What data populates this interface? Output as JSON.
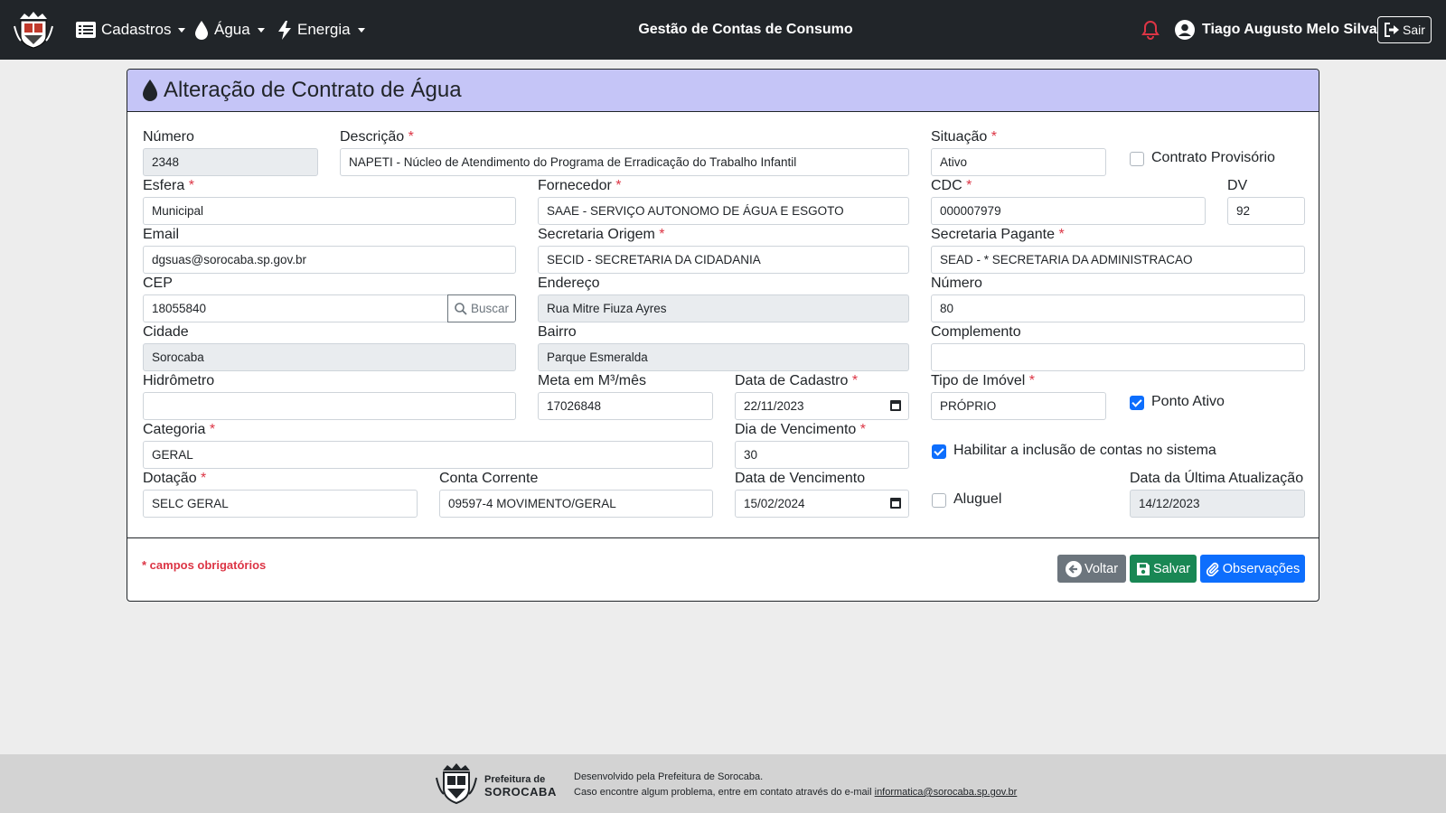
{
  "navbar": {
    "menus": [
      {
        "label": "Cadastros"
      },
      {
        "label": "Água"
      },
      {
        "label": "Energia"
      }
    ],
    "title": "Gestão de Contas de Consumo",
    "user_name": "Tiago Augusto Melo Silva",
    "logout_label": "Sair"
  },
  "card": {
    "title": "Alteração de Contrato de Água"
  },
  "form": {
    "numero": {
      "label": "Número",
      "value": "2348"
    },
    "descricao": {
      "label": "Descrição",
      "value": "NAPETI - Núcleo de Atendimento do Programa de Erradicação do Trabalho Infantil"
    },
    "situacao": {
      "label": "Situação",
      "value": "Ativo"
    },
    "contrato_provisorio": {
      "label": "Contrato Provisório",
      "checked": false
    },
    "esfera": {
      "label": "Esfera",
      "value": "Municipal"
    },
    "fornecedor": {
      "label": "Fornecedor",
      "value": "SAAE - SERVIÇO AUTONOMO DE ÁGUA E ESGOTO"
    },
    "cdc": {
      "label": "CDC",
      "value": "000007979"
    },
    "dv": {
      "label": "DV",
      "value": "92"
    },
    "email": {
      "label": "Email",
      "value": "dgsuas@sorocaba.sp.gov.br"
    },
    "secretaria_origem": {
      "label": "Secretaria Origem",
      "value": "SECID - SECRETARIA DA CIDADANIA"
    },
    "secretaria_pagante": {
      "label": "Secretaria Pagante",
      "value": "SEAD - * SECRETARIA DA ADMINISTRACAO"
    },
    "cep": {
      "label": "CEP",
      "value": "18055840",
      "button_label": "Buscar"
    },
    "endereco": {
      "label": "Endereço",
      "value": "Rua Mitre Fiuza Ayres"
    },
    "numero_end": {
      "label": "Número",
      "value": "80"
    },
    "cidade": {
      "label": "Cidade",
      "value": "Sorocaba"
    },
    "bairro": {
      "label": "Bairro",
      "value": "Parque Esmeralda"
    },
    "complemento": {
      "label": "Complemento",
      "value": ""
    },
    "hidrometro": {
      "label": "Hidrômetro",
      "value": ""
    },
    "meta": {
      "label": "Meta em M³/mês",
      "value": "17026848"
    },
    "data_cadastro": {
      "label": "Data de Cadastro",
      "value": "22/11/2023"
    },
    "tipo_imovel": {
      "label": "Tipo de Imóvel",
      "value": "PRÓPRIO"
    },
    "ponto_ativo": {
      "label": "Ponto Ativo",
      "checked": true
    },
    "categoria": {
      "label": "Categoria",
      "value": "GERAL"
    },
    "dia_vencimento": {
      "label": "Dia de Vencimento",
      "value": "30"
    },
    "habilitar_inclusao": {
      "label": "Habilitar a inclusão de contas no sistema",
      "checked": true
    },
    "dotacao": {
      "label": "Dotação",
      "value": "SELC GERAL"
    },
    "conta_corrente": {
      "label": "Conta Corrente",
      "value": "09597-4 MOVIMENTO/GERAL"
    },
    "data_vencimento": {
      "label": "Data de Vencimento",
      "value": "15/02/2024"
    },
    "aluguel": {
      "label": "Aluguel",
      "checked": false
    },
    "ultima_atualizacao": {
      "label": "Data da Última Atualização",
      "value": "14/12/2023"
    },
    "required_mark": "*"
  },
  "card_footer": {
    "required_note": "* campos obrigatórios",
    "voltar_label": "Voltar",
    "salvar_label": "Salvar",
    "observacoes_label": "Observações"
  },
  "footer": {
    "brand_line1": "Prefeitura de",
    "brand_line2": "SOROCABA",
    "line1": "Desenvolvido pela Prefeitura de Sorocaba.",
    "line2": "Caso encontre algum problema, entre em contato através do e-mail",
    "email": "informatica@sorocaba.sp.gov.br"
  },
  "colors": {
    "navbar_bg": "#212529",
    "card_header_bg": "#c5c5f7",
    "required": "#dc3545",
    "primary": "#0d6efd",
    "success": "#198754",
    "secondary": "#6c757d"
  }
}
